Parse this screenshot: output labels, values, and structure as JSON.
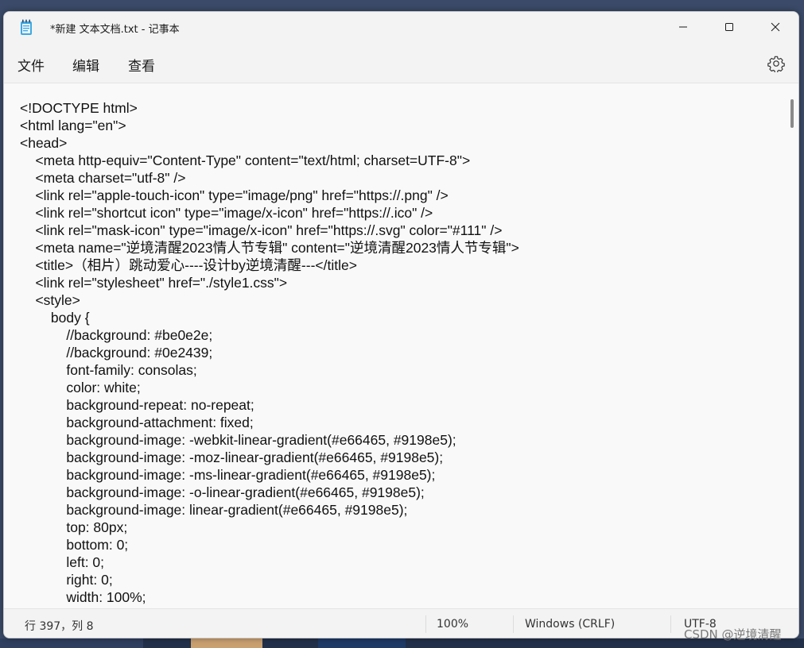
{
  "window": {
    "title": "*新建 文本文档.txt - 记事本",
    "controls": [
      "minimize-icon",
      "maximize-icon",
      "close-icon"
    ]
  },
  "menu": {
    "items": [
      {
        "label": "文件"
      },
      {
        "label": "编辑"
      },
      {
        "label": "查看"
      }
    ],
    "settings_icon": "gear-icon"
  },
  "editor": {
    "lines": [
      "<!DOCTYPE html>",
      "<html lang=\"en\">",
      "<head>",
      "    <meta http-equiv=\"Content-Type\" content=\"text/html; charset=UTF-8\">",
      "    <meta charset=\"utf-8\" />",
      "    <link rel=\"apple-touch-icon\" type=\"image/png\" href=\"https://.png\" />",
      "    <link rel=\"shortcut icon\" type=\"image/x-icon\" href=\"https://.ico\" />",
      "    <link rel=\"mask-icon\" type=\"image/x-icon\" href=\"https://.svg\" color=\"#111\" />",
      "    <meta name=\"逆境清醒2023情人节专辑\" content=\"逆境清醒2023情人节专辑\">",
      "    <title>（相片）跳动爱心----设计by逆境清醒---</title>",
      "    <link rel=\"stylesheet\" href=\"./style1.css\">",
      "    <style>",
      "        body {",
      "            //background: #be0e2e;",
      "            //background: #0e2439;",
      "            font-family: consolas;",
      "            color: white;",
      "            background-repeat: no-repeat;",
      "            background-attachment: fixed;",
      "            background-image: -webkit-linear-gradient(#e66465, #9198e5);",
      "            background-image: -moz-linear-gradient(#e66465, #9198e5);",
      "            background-image: -ms-linear-gradient(#e66465, #9198e5);",
      "            background-image: -o-linear-gradient(#e66465, #9198e5);",
      "            background-image: linear-gradient(#e66465, #9198e5);",
      "            top: 80px;",
      "            bottom: 0;",
      "            left: 0;",
      "            right: 0;",
      "            width: 100%;"
    ]
  },
  "status": {
    "position": "行 397，列 8",
    "zoom": "100%",
    "line_ending": "Windows (CRLF)",
    "encoding": "UTF-8"
  },
  "watermark": "CSDN @逆境清醒"
}
